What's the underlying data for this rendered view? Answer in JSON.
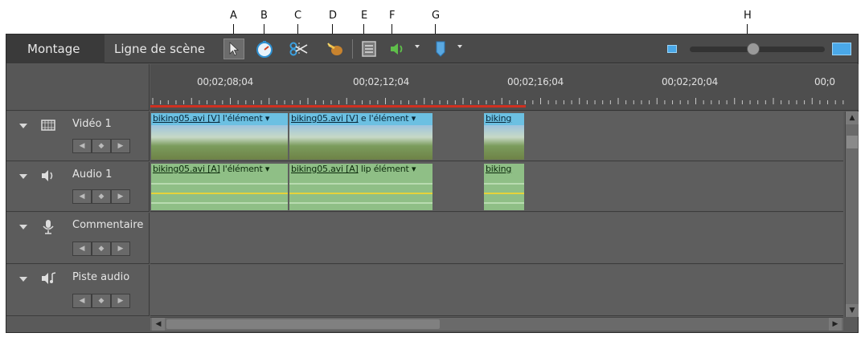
{
  "callouts": [
    "A",
    "B",
    "C",
    "D",
    "E",
    "F",
    "G",
    "H"
  ],
  "tabs": {
    "montage": "Montage",
    "scene_line": "Ligne de scène"
  },
  "tools": {
    "selection": "arrow-cursor-icon",
    "time_stretch": "stopwatch-icon",
    "split": "scissors-icon",
    "smart_fix": "smart-trim-icon",
    "properties": "list-icon",
    "audio": "speaker-icon",
    "marker": "marker-icon"
  },
  "zoom": {
    "level": 0.47
  },
  "ruler": {
    "timecodes": [
      "00;02;08;04",
      "00;02;12;04",
      "00;02;16;04",
      "00;02;20;04",
      "00;0"
    ]
  },
  "tracks": [
    {
      "name": "Vidéo 1",
      "icon": "film-icon",
      "clips": [
        "biking05.avi [V]",
        "l'élément ▾",
        "biking05.avi [V]",
        "e l'élément ▾",
        "biking"
      ]
    },
    {
      "name": "Audio 1",
      "icon": "speaker-icon",
      "clips": [
        "biking05.avi [A]",
        "l'élément ▾",
        "biking05.avi [A]",
        "lip élément ▾",
        "biking"
      ]
    },
    {
      "name": "Commentaire",
      "icon": "microphone-icon",
      "clips": []
    },
    {
      "name": "Piste audio",
      "icon": "music-speaker-icon",
      "clips": []
    }
  ],
  "colors": {
    "video_clip": "#4aa7cf",
    "audio_clip": "#8fbf86",
    "playback_range": "#d03020",
    "audio_level": "#e6d23a"
  }
}
